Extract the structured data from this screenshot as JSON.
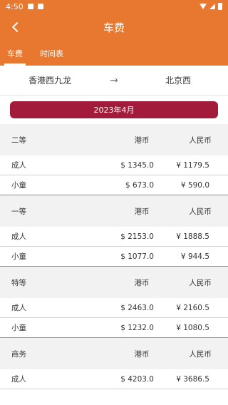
{
  "status_bar": {
    "time": "4:50"
  },
  "app_bar": {
    "title": "车费"
  },
  "tabs": [
    {
      "label": "车费",
      "active": true
    },
    {
      "label": "时间表",
      "active": false
    }
  ],
  "route": {
    "from": "香港西九龙",
    "to": "北京西"
  },
  "month": "2023年4月",
  "fare_groups": [
    {
      "class": "二等",
      "col_hkd": "港币",
      "col_rmb": "人民币",
      "rows": [
        {
          "type": "成人",
          "hkd": "$ 1345.0",
          "rmb": "¥ 1179.5"
        },
        {
          "type": "小童",
          "hkd": "$ 673.0",
          "rmb": "¥ 590.0"
        }
      ]
    },
    {
      "class": "一等",
      "col_hkd": "港币",
      "col_rmb": "人民币",
      "rows": [
        {
          "type": "成人",
          "hkd": "$ 2153.0",
          "rmb": "¥ 1888.5"
        },
        {
          "type": "小童",
          "hkd": "$ 1077.0",
          "rmb": "¥ 944.5"
        }
      ]
    },
    {
      "class": "特等",
      "col_hkd": "港币",
      "col_rmb": "人民币",
      "rows": [
        {
          "type": "成人",
          "hkd": "$ 2463.0",
          "rmb": "¥ 2160.5"
        },
        {
          "type": "小童",
          "hkd": "$ 1232.0",
          "rmb": "¥ 1080.5"
        }
      ]
    },
    {
      "class": "商务",
      "col_hkd": "港币",
      "col_rmb": "人民币",
      "rows": [
        {
          "type": "成人",
          "hkd": "$ 4203.0",
          "rmb": "¥ 3686.5"
        }
      ]
    }
  ],
  "colors": {
    "primary": "#e8782f",
    "month_button": "#a31b3a",
    "group_header_bg": "#f2f2f2"
  }
}
